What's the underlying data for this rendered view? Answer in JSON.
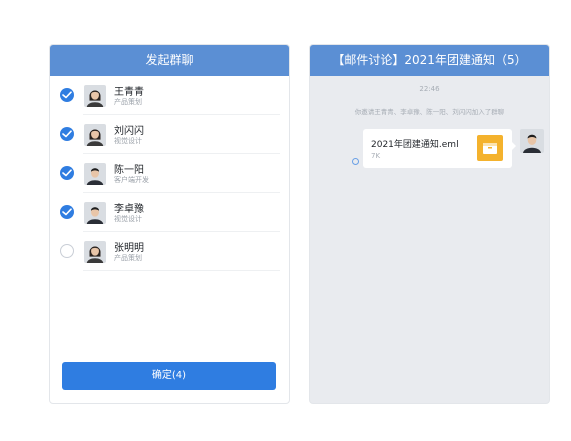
{
  "left": {
    "title": "发起群聊",
    "members": [
      {
        "name": "王青青",
        "role": "产品策划",
        "checked": true,
        "avatar": "female-avatar"
      },
      {
        "name": "刘闪闪",
        "role": "视觉设计",
        "checked": true,
        "avatar": "female-avatar"
      },
      {
        "name": "陈一阳",
        "role": "客户端开发",
        "checked": true,
        "avatar": "male-avatar"
      },
      {
        "name": "李卓豫",
        "role": "视觉设计",
        "checked": true,
        "avatar": "male-avatar"
      },
      {
        "name": "张明明",
        "role": "产品策划",
        "checked": false,
        "avatar": "female-avatar"
      }
    ],
    "confirm_label": "确定(4)"
  },
  "right": {
    "title": "【邮件讨论】2021年团建通知（5）",
    "timestamp": "22:46",
    "system_message": "你邀请王青青、李卓豫、陈一阳、刘闪闪加入了群聊",
    "file": {
      "name": "2021年团建通知.eml",
      "size": "7K",
      "icon": "mail-file-icon"
    },
    "sender_avatar": "male-avatar"
  },
  "colors": {
    "header": "#5b8fd4",
    "primary": "#2f7de1",
    "chat_bg": "#e9ebef",
    "file_icon": "#f4b22d"
  }
}
